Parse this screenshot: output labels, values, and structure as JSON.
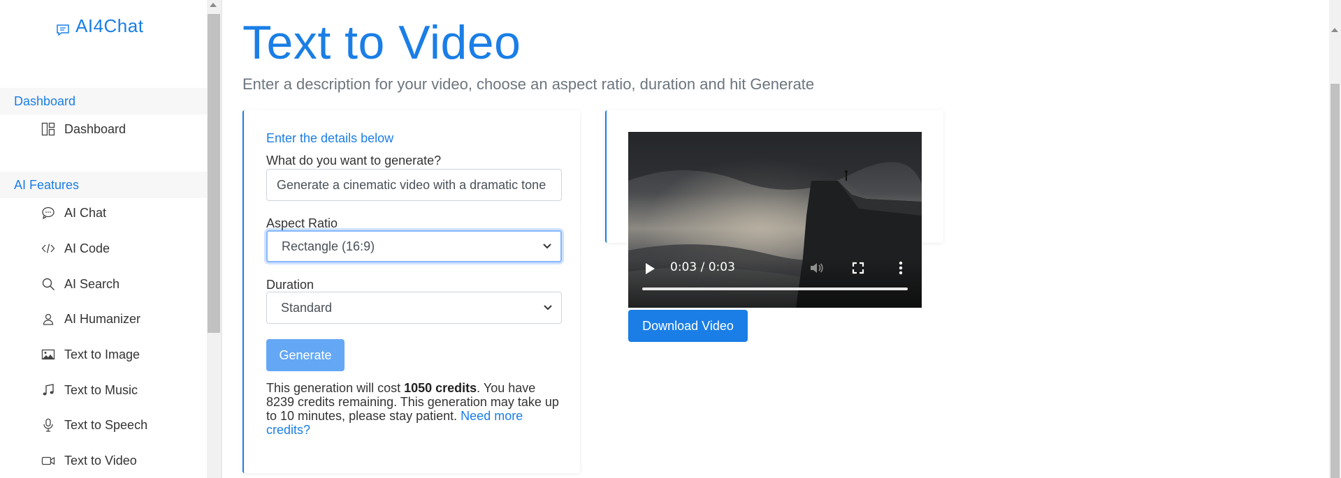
{
  "brand": {
    "name": "AI4Chat"
  },
  "sidebar": {
    "sections": [
      {
        "title": "Dashboard",
        "items": [
          {
            "label": "Dashboard",
            "icon": "dashboard-icon"
          }
        ]
      },
      {
        "title": "AI Features",
        "items": [
          {
            "label": "AI Chat",
            "icon": "chat-bubble-icon"
          },
          {
            "label": "AI Code",
            "icon": "code-icon"
          },
          {
            "label": "AI Search",
            "icon": "search-icon"
          },
          {
            "label": "AI Humanizer",
            "icon": "person-icon"
          },
          {
            "label": "Text to Image",
            "icon": "image-icon"
          },
          {
            "label": "Text to Music",
            "icon": "music-note-icon"
          },
          {
            "label": "Text to Speech",
            "icon": "microphone-icon"
          },
          {
            "label": "Text to Video",
            "icon": "video-camera-icon"
          }
        ]
      }
    ]
  },
  "main": {
    "title": "Text to Video",
    "subtitle": "Enter a description for your video, choose an aspect ratio, duration and hit Generate",
    "form": {
      "heading": "Enter the details below",
      "prompt_label": "What do you want to generate?",
      "prompt_value": "Generate a cinematic video with a dramatic tone",
      "aspect_label": "Aspect Ratio",
      "aspect_value": "Rectangle (16:9)",
      "duration_label": "Duration",
      "duration_value": "Standard",
      "generate_label": "Generate",
      "cost_prefix": "This generation will cost ",
      "cost_amount": "1050 credits",
      "cost_middle": ". You have 8239 credits remaining. This generation may take up to 10 minutes, please stay patient. ",
      "cost_link": "Need more credits?"
    },
    "video": {
      "time": "0:03 / 0:03",
      "progress": 1.0,
      "download_label": "Download Video"
    }
  },
  "colors": {
    "accent": "#1a7ee6",
    "generate_button": "#64a8f5"
  }
}
